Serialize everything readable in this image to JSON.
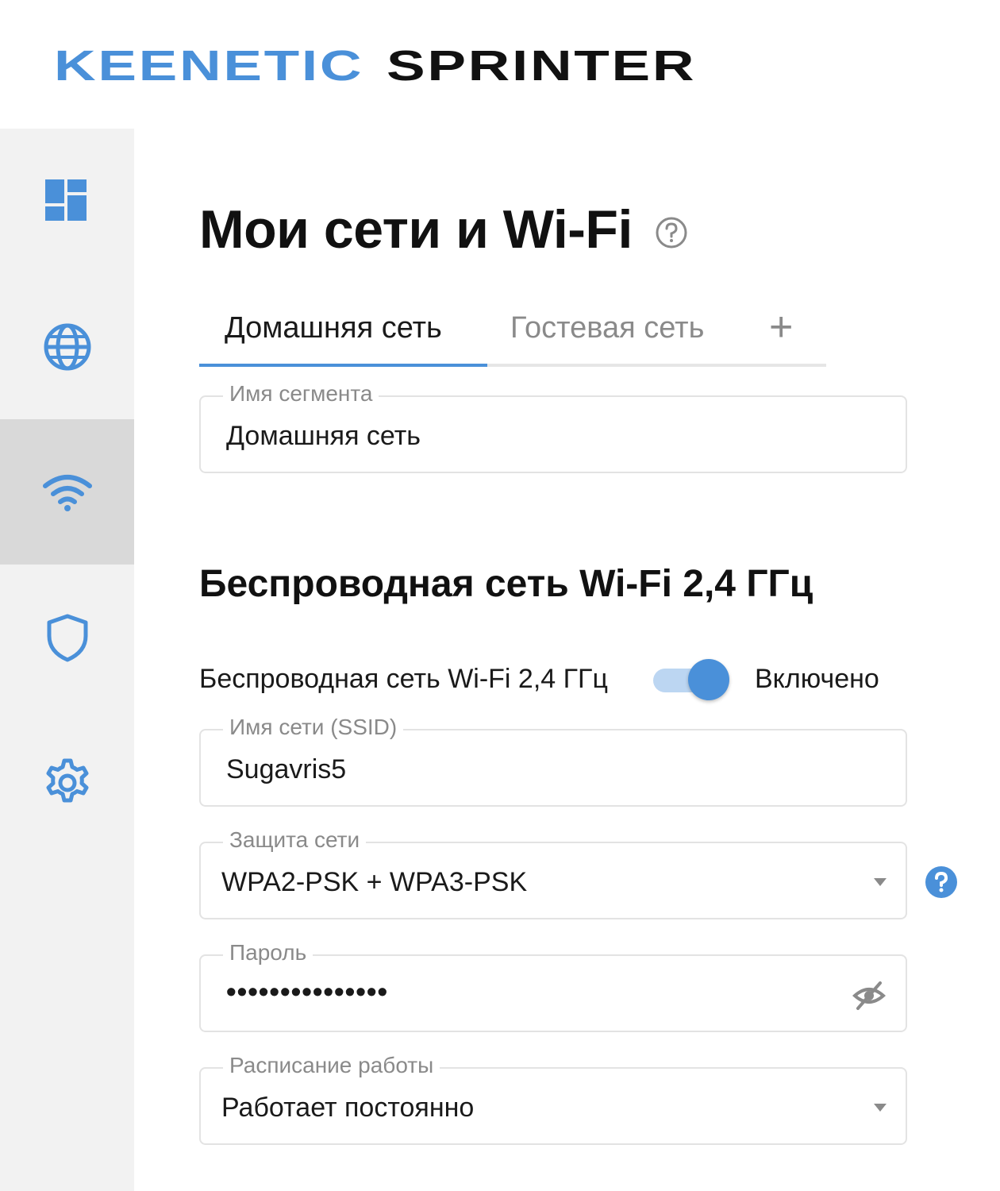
{
  "header": {
    "brand": "KEENETIC",
    "model": "SPRINTER"
  },
  "sidebar": {
    "items": [
      {
        "icon": "dashboard-icon",
        "active": false
      },
      {
        "icon": "globe-icon",
        "active": false
      },
      {
        "icon": "wifi-icon",
        "active": true
      },
      {
        "icon": "shield-icon",
        "active": false
      },
      {
        "icon": "gear-icon",
        "active": false
      }
    ]
  },
  "page": {
    "title": "Мои сети и Wi-Fi"
  },
  "tabs": [
    {
      "label": "Домашняя сеть",
      "active": true
    },
    {
      "label": "Гостевая сеть",
      "active": false
    }
  ],
  "tab_add": "+",
  "segment": {
    "label": "Имя сегмента",
    "value": "Домашняя сеть"
  },
  "wifi24": {
    "section_title": "Беспроводная сеть Wi-Fi 2,4 ГГц",
    "toggle_label": "Беспроводная сеть Wi-Fi 2,4 ГГц",
    "toggle_on": true,
    "toggle_state": "Включено",
    "ssid": {
      "label": "Имя сети (SSID)",
      "value": "Sugavris5"
    },
    "security": {
      "label": "Защита сети",
      "value": "WPA2-PSK + WPA3-PSK"
    },
    "password": {
      "label": "Пароль",
      "value": "•••••••••••••••"
    },
    "schedule": {
      "label": "Расписание работы",
      "value": "Работает постоянно"
    }
  },
  "colors": {
    "accent": "#4a90d9",
    "sidebar_bg": "#f2f2f2",
    "sidebar_active_bg": "#d9d9d9"
  }
}
